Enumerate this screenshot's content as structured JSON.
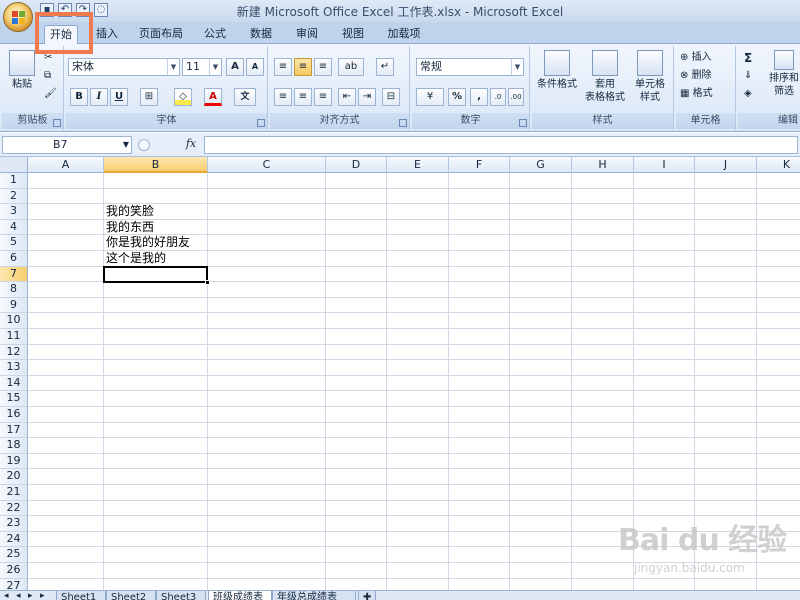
{
  "window": {
    "title": "新建 Microsoft Office Excel 工作表.xlsx - Microsoft Excel",
    "qat": [
      "save",
      "undo",
      "redo",
      "print-preview"
    ]
  },
  "tabs": [
    {
      "label": "开始",
      "active": true
    },
    {
      "label": "插入"
    },
    {
      "label": "页面布局"
    },
    {
      "label": "公式"
    },
    {
      "label": "数据"
    },
    {
      "label": "审阅"
    },
    {
      "label": "视图"
    },
    {
      "label": "加载项"
    }
  ],
  "ribbon": {
    "clipboard": {
      "label": "剪贴板",
      "paste": "粘贴"
    },
    "font": {
      "label": "字体",
      "name": "宋体",
      "size": "11",
      "bold": "B",
      "italic": "I",
      "underline": "U"
    },
    "alignment": {
      "label": "对齐方式"
    },
    "number": {
      "label": "数字",
      "format": "常规",
      "percent": "%",
      "comma": ","
    },
    "styles": {
      "label": "样式",
      "conditional": "条件格式",
      "table_line1": "套用",
      "table_line2": "表格格式",
      "cell_line1": "单元格",
      "cell_line2": "样式"
    },
    "cells": {
      "label": "单元格",
      "insert": "插入",
      "delete": "删除",
      "format": "格式"
    },
    "editing": {
      "label": "编辑",
      "sort_line1": "排序和",
      "sort_line2": "筛选",
      "sigma": "Σ"
    }
  },
  "formula_bar": {
    "name_box": "B7",
    "fx": "fx",
    "value": ""
  },
  "sheet": {
    "columns": [
      "A",
      "B",
      "C",
      "D",
      "E",
      "F",
      "G",
      "H",
      "I",
      "J",
      "K"
    ],
    "rows": [
      "1",
      "2",
      "3",
      "4",
      "5",
      "6",
      "7",
      "8",
      "9",
      "10",
      "11",
      "12",
      "13",
      "14",
      "15",
      "16",
      "17",
      "18",
      "19",
      "20",
      "21",
      "22",
      "23",
      "24",
      "25",
      "26",
      "27"
    ],
    "active_cell": "B7",
    "cells": {
      "B3": "我的笑脸",
      "B4": "我的东西",
      "B5": "你是我的好朋友",
      "B6": "这个是我的"
    }
  },
  "sheet_tabs": {
    "items": [
      "Sheet1",
      "Sheet2",
      "Sheet3",
      "班级成绩表",
      "年级总成绩表"
    ],
    "active": "班级成绩表"
  },
  "watermark": {
    "line1": "Bai du 经验",
    "line2": "jingyan.baidu.com"
  },
  "colors": {
    "highlight": "#f07a4e",
    "ribbon": "#d9e6f6",
    "tabs": "#bfd3ec",
    "active_header": "#f7cd6c"
  }
}
